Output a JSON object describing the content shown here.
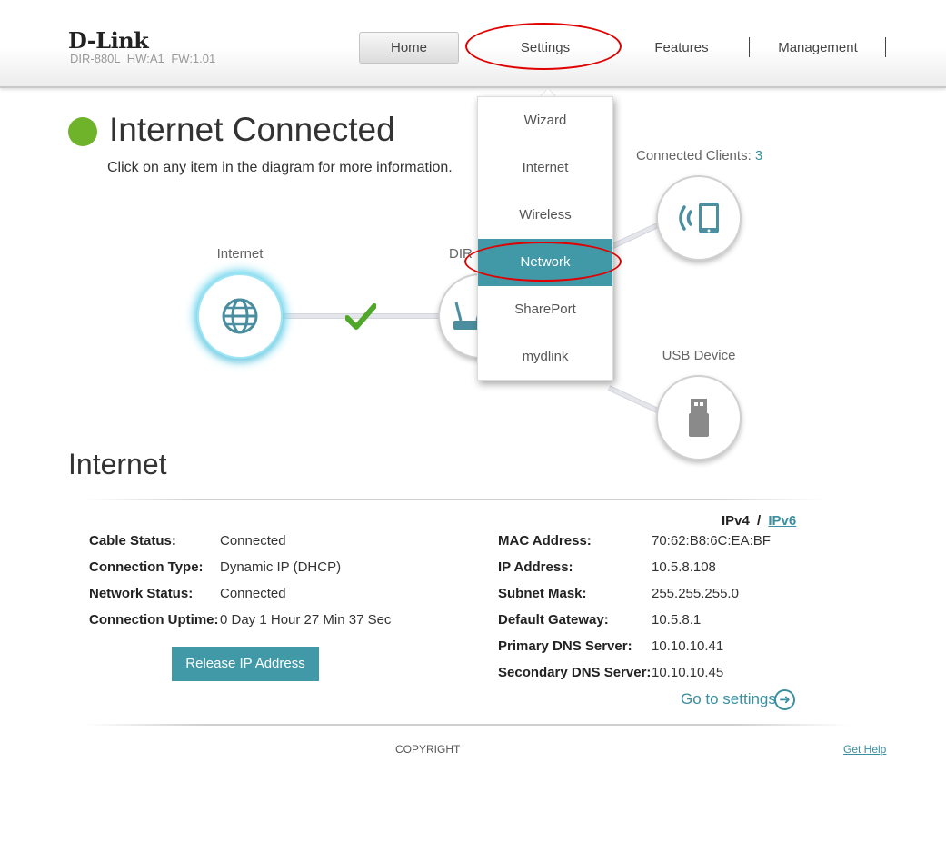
{
  "header": {
    "logo": "D-Link",
    "model": "DIR-880L",
    "hw": "HW:A1",
    "fw": "FW:1.01"
  },
  "nav": {
    "home": "Home",
    "settings": "Settings",
    "features": "Features",
    "management": "Management"
  },
  "settings_menu": {
    "items": [
      "Wizard",
      "Internet",
      "Wireless",
      "Network",
      "SharePort",
      "mydlink"
    ],
    "active": "Network"
  },
  "status": {
    "title": "Internet Connected",
    "subtitle": "Click on any item in the diagram for more information.",
    "color": "#6fb32a"
  },
  "diagram": {
    "internet_label": "Internet",
    "router_label_partial": "DIR",
    "clients_label": "Connected Clients:",
    "clients_count": "3",
    "usb_label": "USB Device",
    "icons": [
      "globe-icon",
      "check-icon",
      "router-icon",
      "wireless-tablet-icon",
      "usb-drive-icon"
    ]
  },
  "internet": {
    "title": "Internet",
    "ipv4": "IPv4",
    "separator": "/",
    "ipv6": "IPv6",
    "left": [
      {
        "label": "Cable Status:",
        "value": "Connected"
      },
      {
        "label": "Connection Type:",
        "value": "Dynamic IP (DHCP)"
      },
      {
        "label": "Network Status:",
        "value": "Connected"
      },
      {
        "label": "Connection Uptime:",
        "value": "0 Day 1 Hour 27 Min 37 Sec"
      }
    ],
    "right": [
      {
        "label": "MAC Address:",
        "value": "70:62:B8:6C:EA:BF"
      },
      {
        "label": "IP Address:",
        "value": "10.5.8.108"
      },
      {
        "label": "Subnet Mask:",
        "value": "255.255.255.0"
      },
      {
        "label": "Default Gateway:",
        "value": "10.5.8.1"
      },
      {
        "label": "Primary DNS Server:",
        "value": "10.10.10.41"
      },
      {
        "label": "Secondary DNS Server:",
        "value": "10.10.10.45"
      }
    ],
    "release_button": "Release IP Address",
    "goto_settings": "Go to settings"
  },
  "footer": {
    "copyright": "COPYRIGHT",
    "help": "Get Help"
  },
  "colors": {
    "accent": "#4198a7",
    "annotation": "#e00000"
  }
}
